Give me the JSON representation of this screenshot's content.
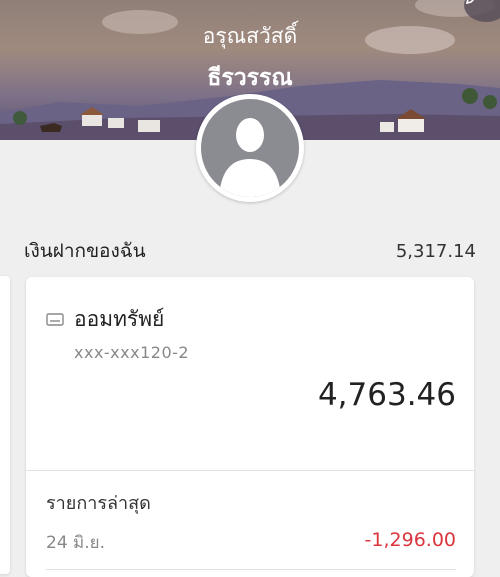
{
  "header": {
    "greeting": "อรุณสวัสดิ์",
    "user_name": "ธีรวรรณ"
  },
  "edit_icon": "pencil-icon",
  "avatar_icon": "user-silhouette-icon",
  "deposits": {
    "label": "เงินฝากของฉัน",
    "total": "5,317.14"
  },
  "account": {
    "icon": "card-icon",
    "name": "ออมทรัพย์",
    "number": "xxx-xxx120-2",
    "balance": "4,763.46"
  },
  "recent": {
    "title": "รายการล่าสุด",
    "transactions": [
      {
        "date": "24 มิ.ย.",
        "amount": "-1,296.00"
      }
    ]
  },
  "colors": {
    "negative_amount": "#d9363e",
    "background": "#efefef"
  }
}
